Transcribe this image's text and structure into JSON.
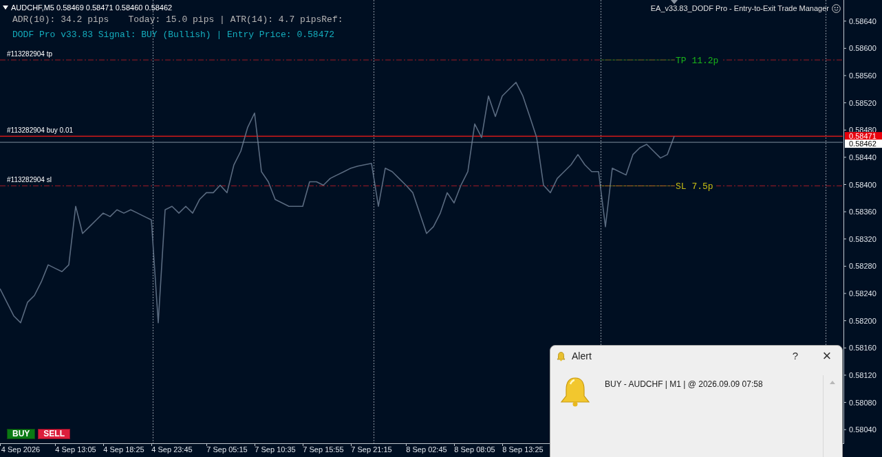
{
  "chart_header": {
    "symbol_line": "AUDCHF,M5  0.58469 0.58471 0.58460 0.58462",
    "ea_title": "EA_v33.83_DODF Pro - Entry-to-Exit Trade Manager"
  },
  "info_panel": [
    {
      "kind": "stats",
      "texts": [
        "ADR(10): 34.2 pips",
        "Today: 15.0 pips | ATR(14): 4.7 pipsRef:"
      ]
    },
    {
      "kind": "signal",
      "texts": [
        "DODF Pro v33.83 Signal: BUY (Bullish) | Entry Price: 0.58472"
      ]
    }
  ],
  "chart_data": {
    "type": "line",
    "categories": [
      null,
      null,
      null,
      "4 Sep 2026",
      null,
      null,
      null,
      null,
      null,
      null,
      null,
      "4 Sep 13:05",
      null,
      null,
      null,
      null,
      null,
      null,
      "4 Sep 18:25",
      null,
      null,
      null,
      null,
      null,
      null,
      "4 Sep 23:45",
      null,
      null,
      null,
      null,
      null,
      null,
      null,
      "7 Sep 05:15",
      null,
      null,
      null,
      null,
      null,
      null,
      "7 Sep 10:35",
      null,
      null,
      null,
      null,
      null,
      null,
      "7 Sep 15:55",
      null,
      null,
      null,
      null,
      null,
      null,
      "7 Sep 21:15",
      null,
      null,
      null,
      null,
      null,
      null,
      null,
      "8 Sep 02:45",
      null,
      null,
      null,
      null,
      null,
      null,
      "8 Sep 08:05",
      null,
      null,
      null,
      null,
      null,
      null,
      "8 Sep 13:25",
      null,
      null,
      null,
      null,
      null,
      null,
      null,
      null,
      null,
      null,
      null,
      null,
      null,
      null,
      null,
      null,
      null,
      null,
      null,
      null,
      null,
      null
    ],
    "series": [
      {
        "color": "#5a6b80",
        "values": [
          0.58247,
          0.58227,
          0.58207,
          0.58197,
          0.58227,
          0.58237,
          0.58257,
          0.58282,
          0.58277,
          0.58272,
          0.58282,
          0.58368,
          0.58328,
          0.58338,
          0.58348,
          0.58358,
          0.58353,
          0.58363,
          0.58358,
          0.58363,
          0.58358,
          0.58353,
          0.58348,
          0.58197,
          0.58363,
          0.58368,
          0.58358,
          0.58368,
          0.58358,
          0.58378,
          0.58388,
          0.58388,
          0.58399,
          0.58388,
          0.58429,
          0.58449,
          0.58484,
          0.58505,
          0.58419,
          0.58404,
          0.58378,
          0.58373,
          0.58368,
          0.58368,
          0.58368,
          0.58404,
          0.58404,
          0.58399,
          0.58409,
          0.58414,
          0.58419,
          0.58424,
          0.58427,
          0.58429,
          0.58431,
          0.58368,
          0.58424,
          0.58419,
          0.58409,
          0.58399,
          0.58388,
          0.58358,
          0.58328,
          0.58338,
          0.58358,
          0.58388,
          0.58373,
          0.58399,
          0.58419,
          0.58489,
          0.58469,
          0.5853,
          0.585,
          0.5853,
          0.5854,
          0.5855,
          0.5853,
          0.585,
          0.58469,
          0.58399,
          0.58388,
          0.58409,
          0.58419,
          0.58429,
          0.58444,
          0.58429,
          0.58419,
          0.58419,
          0.58338,
          0.58424,
          0.58419,
          0.58414,
          0.58444,
          0.58454,
          0.58459,
          0.58449,
          0.58439,
          0.58444,
          0.58471
        ]
      }
    ],
    "ylim": [
      0.5802,
      0.58671
    ],
    "yticks": [
      {
        "value": 0.5864,
        "label": "0.58640"
      },
      {
        "value": 0.586,
        "label": "0.58600"
      },
      {
        "value": 0.5856,
        "label": "0.58560"
      },
      {
        "value": 0.5852,
        "label": "0.58520"
      },
      {
        "value": 0.5848,
        "label": "0.58480"
      },
      {
        "value": 0.5844,
        "label": "0.58440"
      },
      {
        "value": 0.584,
        "label": "0.58400"
      },
      {
        "value": 0.5836,
        "label": "0.58360"
      },
      {
        "value": 0.5832,
        "label": "0.58320"
      },
      {
        "value": 0.5828,
        "label": "0.58280"
      },
      {
        "value": 0.5824,
        "label": "0.58240"
      },
      {
        "value": 0.582,
        "label": "0.58200"
      },
      {
        "value": 0.5816,
        "label": "0.58160"
      },
      {
        "value": 0.5812,
        "label": "0.58120"
      },
      {
        "value": 0.5808,
        "label": "0.58080"
      },
      {
        "value": 0.5804,
        "label": "0.58040"
      }
    ],
    "ref_lines": [
      {
        "axis": "y",
        "value": 0.58583,
        "label": "#113282904 tp"
      },
      {
        "axis": "y",
        "value": 0.58471,
        "label": "#113282904 buy 0.01"
      },
      {
        "axis": "y",
        "value": 0.58398,
        "label": "#113282904 sl"
      },
      {
        "axis": "y",
        "value": 0.58462,
        "label": "0.58462"
      }
    ],
    "annotations": [
      {
        "y": 0.58583,
        "text": "TP 11.2p"
      },
      {
        "y": 0.58398,
        "text": "SL 7.5p"
      },
      "0.58471"
    ]
  },
  "trade_buttons": [
    {
      "kind": "buy",
      "label": "BUY"
    },
    {
      "kind": "sell",
      "label": "SELL"
    }
  ],
  "alert": {
    "title": "Alert",
    "help": "?",
    "close": "×",
    "message": "BUY - AUDCHF | M1 | @ 2026.09.09 07:58"
  }
}
